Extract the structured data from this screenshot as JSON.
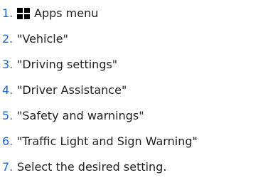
{
  "steps": [
    {
      "number": "1.",
      "icon": "apps-grid-icon",
      "text": "Apps menu"
    },
    {
      "number": "2.",
      "text": "\"Vehicle\""
    },
    {
      "number": "3.",
      "text": "\"Driving settings\""
    },
    {
      "number": "4.",
      "text": "\"Driver Assistance\""
    },
    {
      "number": "5.",
      "text": "\"Safety and warnings\""
    },
    {
      "number": "6.",
      "text": "\"Traffic Light and Sign Warning\""
    },
    {
      "number": "7.",
      "text": "Select the desired setting."
    }
  ],
  "colors": {
    "step_number": "#1c69d4",
    "text": "#222222",
    "icon": "#000000"
  }
}
